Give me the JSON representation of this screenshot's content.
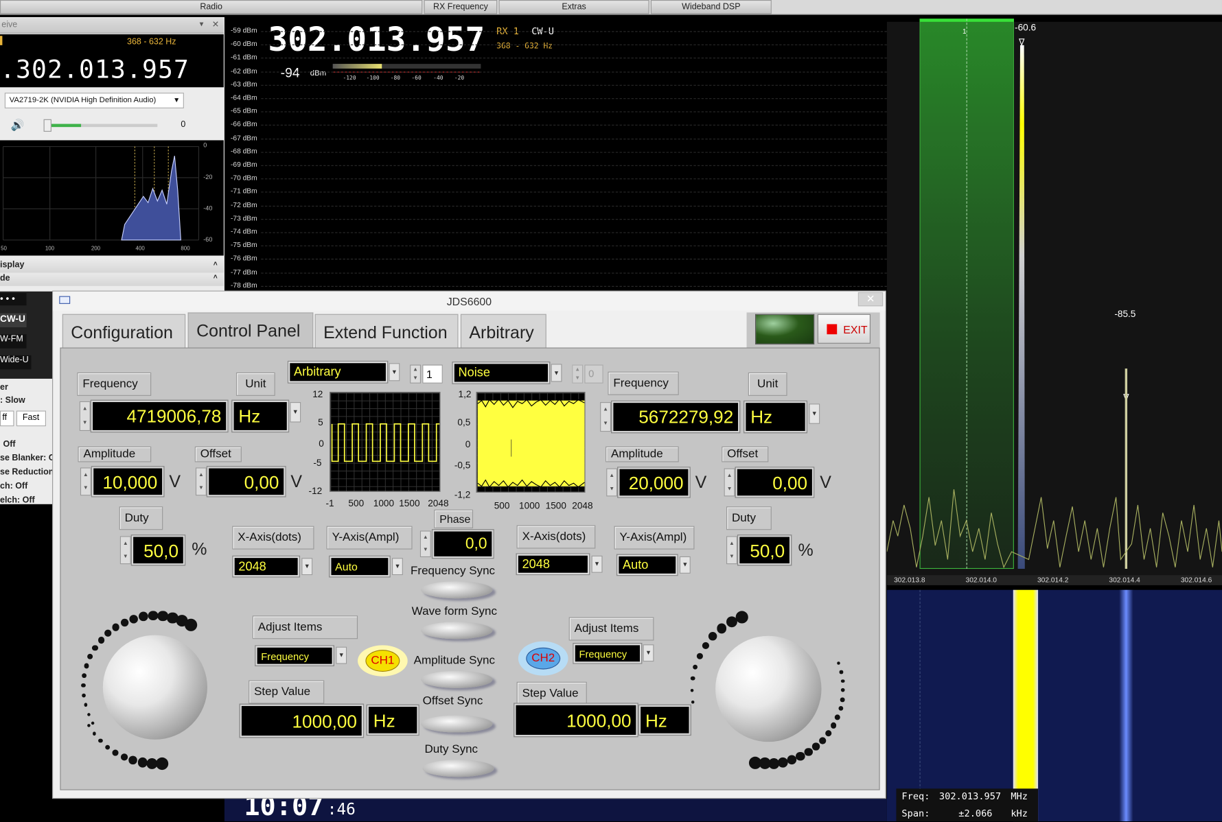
{
  "topbar": {
    "tabs": [
      "Radio",
      "RX Frequency",
      "Extras",
      "Wideband DSP"
    ]
  },
  "rx_panel": {
    "title": "eive",
    "filter_range": "368 - 632 Hz",
    "frequency": "302.013.957",
    "audio_device": "VA2719-2K (NVIDIA High Definition Audio)",
    "volume_value": "0",
    "spectrum_y_ticks": [
      "0",
      "-20",
      "-40",
      "-60"
    ],
    "spectrum_x_ticks": [
      "50",
      "100",
      "200",
      "400",
      "800"
    ],
    "section_display": "isplay",
    "section_mode": "de",
    "modes": [
      "CW-U",
      "W-FM",
      "Wide-U"
    ],
    "mode_selected": "CW-U",
    "agc_label": "er",
    "agc_value": ": Slow",
    "agc_buttons": [
      "ff",
      "Fast"
    ],
    "status": [
      "Off",
      "se Blanker: O",
      "se Reduction",
      "ch: Off",
      "elch: Off"
    ]
  },
  "readout": {
    "frequency": "302.013.957",
    "rx": "RX 1",
    "mode": "CW-U",
    "filter_range": "368 - 632 Hz",
    "smeter_value": "-94",
    "smeter_unit": "dBm",
    "smeter_scale": [
      "-120",
      "-100",
      "-80",
      "-60",
      "-40",
      "-20"
    ],
    "smeter_level": 0.33
  },
  "dbm_scale": [
    "-59 dBm",
    "-60 dBm",
    "-61 dBm",
    "-62 dBm",
    "-63 dBm",
    "-64 dBm",
    "-65 dBm",
    "-66 dBm",
    "-67 dBm",
    "-68 dBm",
    "-69 dBm",
    "-70 dBm",
    "-71 dBm",
    "-72 dBm",
    "-73 dBm",
    "-74 dBm",
    "-75 dBm",
    "-76 dBm",
    "-77 dBm",
    "-78 dBm"
  ],
  "spectrum": {
    "marker1_label": "1",
    "peak1": "-60.6",
    "peak2": "-85.5",
    "x_ticks": [
      "302.013.8",
      "302.014.0",
      "302.014.2",
      "302.014.4",
      "302.014.6"
    ]
  },
  "freq_overlay": {
    "freq_label": "Freq:",
    "freq_value": "302.013.957",
    "freq_unit": "MHz",
    "span_label": "Span:",
    "span_value": "±2.066",
    "span_unit": "kHz"
  },
  "clock": {
    "time": "10:07",
    "seconds": ":46"
  },
  "jds": {
    "title": "JDS6600",
    "tabs": [
      "Configuration",
      "Control Panel",
      "Extend Function",
      "Arbitrary"
    ],
    "active_tab": "Control Panel",
    "exit_label": "EXIT",
    "ch1": {
      "waveform": "Arbitrary",
      "arb_index": "1",
      "frequency_label": "Frequency",
      "frequency": "4719006,78",
      "unit_label": "Unit",
      "unit": "Hz",
      "amplitude_label": "Amplitude",
      "amplitude": "10,000",
      "amplitude_unit": "V",
      "offset_label": "Offset",
      "offset": "0,00",
      "offset_unit": "V",
      "duty_label": "Duty",
      "duty": "50,0",
      "duty_unit": "%",
      "xaxis_label": "X-Axis(dots)",
      "xaxis": "2048",
      "yaxis_label": "Y-Axis(Ampl)",
      "yaxis": "Auto",
      "chart_y_ticks": [
        "12",
        "5",
        "0",
        "-5",
        "-12"
      ],
      "chart_x_ticks": [
        "-1",
        "500",
        "1000",
        "1500",
        "2048"
      ],
      "adjust_label": "Adjust Items",
      "adjust_value": "Frequency",
      "step_label": "Step Value",
      "step": "1000,00",
      "step_unit": "Hz",
      "badge": "CH1"
    },
    "ch2": {
      "waveform": "Noise",
      "arb_index": "0",
      "frequency_label": "Frequency",
      "frequency": "5672279,92",
      "unit_label": "Unit",
      "unit": "Hz",
      "amplitude_label": "Amplitude",
      "amplitude": "20,000",
      "amplitude_unit": "V",
      "offset_label": "Offset",
      "offset": "0,00",
      "offset_unit": "V",
      "duty_label": "Duty",
      "duty": "50,0",
      "duty_unit": "%",
      "xaxis_label": "X-Axis(dots)",
      "xaxis": "2048",
      "yaxis_label": "Y-Axis(Ampl)",
      "yaxis": "Auto",
      "chart_y_ticks": [
        "1,2",
        "0,5",
        "0",
        "-0,5",
        "-1,2"
      ],
      "chart_x_ticks": [
        "500",
        "1000",
        "1500",
        "2048"
      ],
      "adjust_label": "Adjust Items",
      "adjust_value": "Frequency",
      "step_label": "Step Value",
      "step": "1000,00",
      "step_unit": "Hz",
      "badge": "CH2"
    },
    "phase_label": "Phase",
    "phase": "0,0",
    "syncs": [
      "Frequency Sync",
      "Wave form Sync",
      "Amplitude Sync",
      "Offset Sync",
      "Duty Sync"
    ]
  },
  "colors": {
    "lcd_text": "#ffff40",
    "spectrum_green": "#2e9e2e",
    "peak_yellow": "#ffff00",
    "waterfall": "#101a50"
  }
}
